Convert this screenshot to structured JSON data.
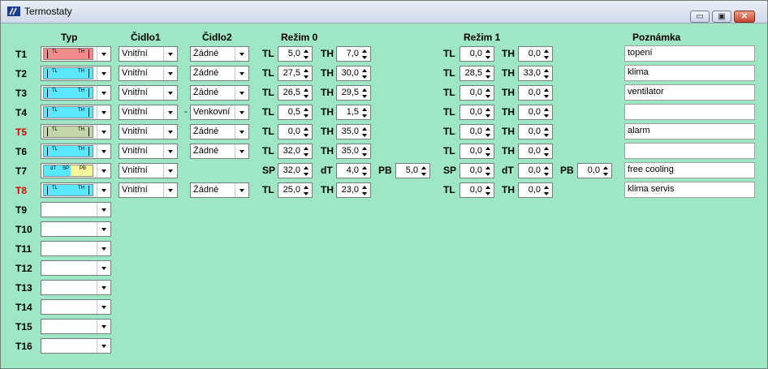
{
  "window": {
    "title": "Termostaty",
    "min_label": "▭",
    "max_label": "▣",
    "close_label": "✕"
  },
  "headers": {
    "typ": "Typ",
    "cidlo1": "Čidlo1",
    "cidlo2": "Čidlo2",
    "rezim0": "Režim 0",
    "rezim1": "Režim 1",
    "poznamka": "Poznámka"
  },
  "rows": [
    {
      "label": "T1",
      "red": false,
      "typ": "hyst",
      "typ_color": "#f28a8a",
      "cidlo1": "Vnitřní",
      "cidlo2": "Žádné",
      "r0": [
        [
          "TL",
          "5,0"
        ],
        [
          "TH",
          "7,0"
        ]
      ],
      "r1": [
        [
          "TL",
          "0,0"
        ],
        [
          "TH",
          "0,0"
        ]
      ],
      "note": "topení"
    },
    {
      "label": "T2",
      "red": false,
      "typ": "hyst",
      "typ_color": "#59e8ff",
      "cidlo1": "Vnitřní",
      "cidlo2": "Žádné",
      "r0": [
        [
          "TL",
          "27,5"
        ],
        [
          "TH",
          "30,0"
        ]
      ],
      "r1": [
        [
          "TL",
          "28,5"
        ],
        [
          "TH",
          "33,0"
        ]
      ],
      "note": "klima"
    },
    {
      "label": "T3",
      "red": false,
      "typ": "hyst",
      "typ_color": "#59e8ff",
      "cidlo1": "Vnitřní",
      "cidlo2": "Žádné",
      "r0": [
        [
          "TL",
          "26,5"
        ],
        [
          "TH",
          "29,5"
        ]
      ],
      "r1": [
        [
          "TL",
          "0,0"
        ],
        [
          "TH",
          "0,0"
        ]
      ],
      "note": "ventilator"
    },
    {
      "label": "T4",
      "red": false,
      "typ": "hyst",
      "typ_color": "#59e8ff",
      "cidlo1": "Vnitřní",
      "cidlo2": "Venkovní",
      "dash": "-",
      "r0": [
        [
          "TL",
          "0,5"
        ],
        [
          "TH",
          "1,5"
        ]
      ],
      "r1": [
        [
          "TL",
          "0,0"
        ],
        [
          "TH",
          "0,0"
        ]
      ],
      "note": ""
    },
    {
      "label": "T5",
      "red": true,
      "typ": "hyst",
      "typ_color": "#c2d6a8",
      "cidlo1": "Vnitřní",
      "cidlo2": "Žádné",
      "r0": [
        [
          "TL",
          "0,0"
        ],
        [
          "TH",
          "35,0"
        ]
      ],
      "r1": [
        [
          "TL",
          "0,0"
        ],
        [
          "TH",
          "0,0"
        ]
      ],
      "note": "alarm"
    },
    {
      "label": "T6",
      "red": false,
      "typ": "hyst",
      "typ_color": "#59e8ff",
      "cidlo1": "Vnitřní",
      "cidlo2": "Žádné",
      "r0": [
        [
          "TL",
          "32,0"
        ],
        [
          "TH",
          "35,0"
        ]
      ],
      "r1": [
        [
          "TL",
          "0,0"
        ],
        [
          "TH",
          "0,0"
        ]
      ],
      "note": ""
    },
    {
      "label": "T7",
      "red": false,
      "typ": "pb",
      "typ_color": "#59e8ff",
      "cidlo1": "Vnitřní",
      "cidlo2": null,
      "r0": [
        [
          "SP",
          "32,0"
        ],
        [
          "dT",
          "4,0"
        ],
        [
          "PB",
          "5,0"
        ]
      ],
      "r1": [
        [
          "SP",
          "0,0"
        ],
        [
          "dT",
          "0,0"
        ],
        [
          "PB",
          "0,0"
        ]
      ],
      "note": "free cooling"
    },
    {
      "label": "T8",
      "red": true,
      "typ": "hyst",
      "typ_color": "#59e8ff",
      "cidlo1": "Vnitřní",
      "cidlo2": "Žádné",
      "r0": [
        [
          "TL",
          "25,0"
        ],
        [
          "TH",
          "23,0"
        ]
      ],
      "r1": [
        [
          "TL",
          "0,0"
        ],
        [
          "TH",
          "0,0"
        ]
      ],
      "note": "klima servis"
    },
    {
      "label": "T9",
      "red": false,
      "typ": null
    },
    {
      "label": "T10",
      "red": false,
      "typ": null
    },
    {
      "label": "T11",
      "red": false,
      "typ": null
    },
    {
      "label": "T12",
      "red": false,
      "typ": null
    },
    {
      "label": "T13",
      "red": false,
      "typ": null
    },
    {
      "label": "T14",
      "red": false,
      "typ": null
    },
    {
      "label": "T15",
      "red": false,
      "typ": null
    },
    {
      "label": "T16",
      "red": false,
      "typ": null
    }
  ],
  "typ_glyphs": {
    "tl": "TL",
    "th": "TH",
    "dt": "dT",
    "sp": "SP",
    "pb": "PB"
  }
}
